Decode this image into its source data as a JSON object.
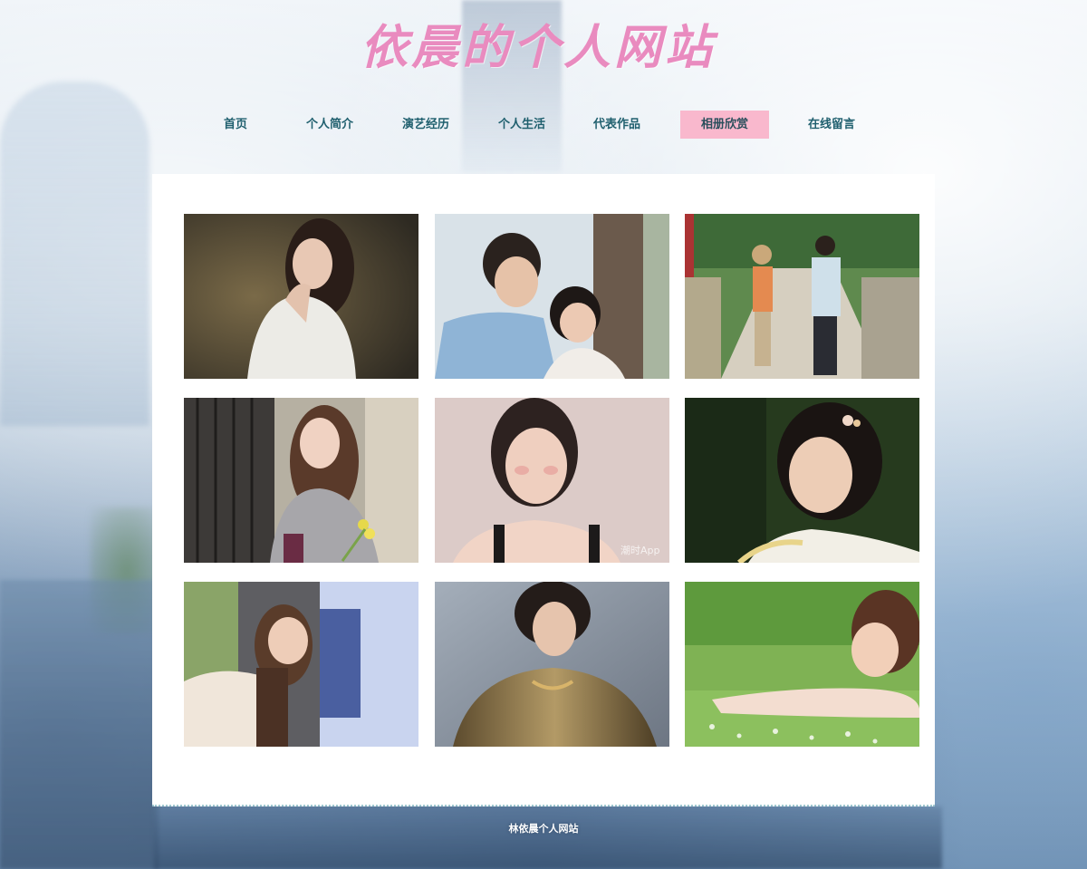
{
  "site": {
    "title": "依晨的个人网站"
  },
  "nav": {
    "items": [
      {
        "label": "首页",
        "active": false
      },
      {
        "label": "个人简介",
        "active": false
      },
      {
        "label": "演艺经历",
        "active": false
      },
      {
        "label": "个人生活",
        "active": false
      },
      {
        "label": "代表作品",
        "active": false
      },
      {
        "label": "相册欣赏",
        "active": true
      },
      {
        "label": "在线留言",
        "active": false
      }
    ],
    "active_color": "#f9b8cd",
    "text_color": "#1f5f6e"
  },
  "gallery": {
    "photos": [
      {
        "name": "photo-portrait-white-shirt"
      },
      {
        "name": "photo-couple-under-tree"
      },
      {
        "name": "photo-couple-on-bridge"
      },
      {
        "name": "photo-girl-with-flowers"
      },
      {
        "name": "photo-short-hair-portrait",
        "watermark": "潮时App"
      },
      {
        "name": "photo-girl-with-hair-flower"
      },
      {
        "name": "photo-girl-by-window"
      },
      {
        "name": "photo-gold-jacket-portrait"
      },
      {
        "name": "photo-girl-on-grass"
      }
    ]
  },
  "footer": {
    "text": "林依晨个人网站"
  },
  "colors": {
    "title_pink": "#e98bbf",
    "panel_bg": "#ffffff"
  }
}
